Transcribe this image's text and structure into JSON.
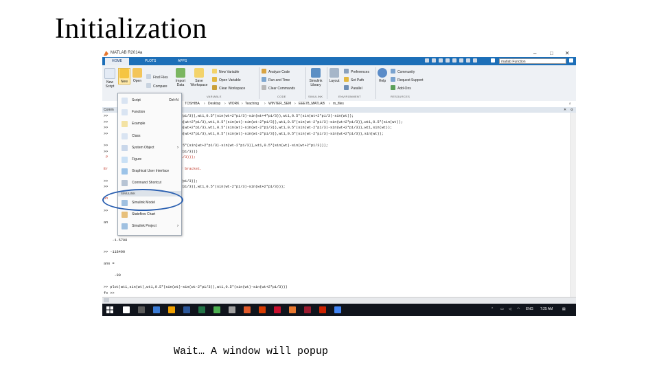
{
  "slide": {
    "title": "Initialization",
    "caption": "Wait… A window will popup"
  },
  "window": {
    "title": "MATLAB R2014a",
    "min": "–",
    "max": "□",
    "close": "✕"
  },
  "tabs": [
    "HOME",
    "PLOTS",
    "APPS"
  ],
  "search": {
    "value": "matlab Function"
  },
  "ribbon": {
    "new_script": "New\nScript",
    "new": "New",
    "open": "Open",
    "find_files": "Find Files",
    "compare": "Compare",
    "import_data": "Import\nData",
    "save_workspace": "Save\nWorkspace",
    "new_variable": "New Variable",
    "open_variable": "Open Variable",
    "clear_workspace": "Clear Workspace",
    "analyze_code": "Analyze Code",
    "run_and_time": "Run and Time",
    "clear_commands": "Clear Commands",
    "simulink_library": "Simulink\nLibrary",
    "layout": "Layout",
    "preferences": "Preferences",
    "set_path": "Set Path",
    "parallel": "Parallel",
    "help": "Help",
    "community": "Community",
    "request_support": "Request Support",
    "add_ons": "Add-Ons",
    "groups": [
      "VARIABLE",
      "CODE",
      "SIMULINK",
      "ENVIRONMENT",
      "RESOURCES"
    ]
  },
  "address": [
    "TOSHIBA",
    "Desktop",
    "WORK",
    "Teaching",
    "WINTER_SEM",
    "EEE78_MATLAB",
    "m_files"
  ],
  "command_window": {
    "title": "Comm",
    "lines": [
      {
        "text": ">>             0.5*(sin(wt)-sin(wt-2*pi/3)),wt1,0.5*(sin(wt+2*pi/3)-sin(wt+4*pi/3)),wt1,0.5*(sin(wt+2*pi/3)-sin(wt));",
        "err": false
      },
      {
        "text": ">>             sin(wt-2*pi/3),wt1,sin(wt+2*pi/3),wt1,0.5*(sin(wt)-sin(wt-2*pi/3)),wt1,0.5*(sin(wt-2*pi/3)-sin(wt+2*pi/3)),wt1,0.5*(sin(wt));",
        "err": false
      },
      {
        "text": ">>             sin(wt-2*pi/3),wt1,sin(wt+2*pi/3),wt1,0.5*(sin(wt)-sin(wt-2*pi/3)),wt1,0.5*(sin(wt-2*pi/3)-sin(wt+2*pi/3)),wt1,sin(wt));",
        "err": false
      },
      {
        "text": ">>             sin(wt-2*pi/3),wt1,sin(wt+2*pi/3),wt1,0.5*(sin(wt)-sin(wt-2*pi/3)),wt1,0.5*(sin(wt-2*pi/3)-sin(wt+2*pi/3)),sin(wt));",
        "err": false
      },
      {
        "text": "",
        "err": false
      },
      {
        "text": ">>             2*pi/3)-sin(wt),wt1,0.5*(sin(wt+2*pi/3)-sin(wt-2*pi/3)),wt1,0.5*(sin(wt)-sin(wt+2*pi/3)));",
        "err": false
      },
      {
        "text": ">>             0.5*(sin(wt)-sin(wt-2*pi/3)))",
        "err": false
      },
      {
        "text": " P             5*(sin(wt)-sin(wt-2*pi/3)));",
        "err": true
      },
      {
        "text": "                 |",
        "err": true
      },
      {
        "text": "Er             xpected parenthesis or bracket.",
        "err": true
      },
      {
        "text": "",
        "err": false
      },
      {
        "text": ">>             0.5*(sin(wt) sin(wt-2*pi/3));",
        "err": false
      },
      {
        "text": ">>             0.5*(sin(wt)-sin(wt+2*pi/3)),wt1,0.5*(sin(wt-2*pi/3)-sin(wt+2*pi/3)));",
        "err": false
      },
      {
        "text": "",
        "err": false
      },
      {
        "text": "Un             iable 'p'.",
        "err": true
      },
      {
        "text": "",
        "err": false
      },
      {
        "text": ">>",
        "err": false
      },
      {
        "text": "",
        "err": false
      },
      {
        "text": "an",
        "err": false
      },
      {
        "text": "",
        "err": false
      },
      {
        "text": "",
        "err": false
      },
      {
        "text": "    -1.5708",
        "err": false
      },
      {
        "text": "",
        "err": false
      },
      {
        "text": ">> -118490",
        "err": false
      },
      {
        "text": "",
        "err": false
      },
      {
        "text": "ans =",
        "err": false
      },
      {
        "text": "",
        "err": false
      },
      {
        "text": "     -90",
        "err": false
      },
      {
        "text": "",
        "err": false
      },
      {
        "text": ">> plot(wt1,sin(wt),wt1,0.5*(sin(wt)-sin(wt-2*pi/3)),wt1,0.5*(sin(wt)-sin(wt+2*pi/3)))",
        "err": false
      },
      {
        "text": "fx >>",
        "err": false
      }
    ]
  },
  "menu": {
    "items": [
      {
        "label": "Script",
        "shortcut": "Ctrl+N",
        "icon": "script-icon",
        "color": "#d9e4f2"
      },
      {
        "label": "Function",
        "shortcut": "",
        "icon": "function-icon",
        "color": "#d9e4f2"
      },
      {
        "label": "Example",
        "shortcut": "",
        "icon": "example-icon",
        "color": "#f3e2a3"
      },
      {
        "label": "Class",
        "shortcut": "",
        "icon": "class-icon",
        "color": "#d9e4f2"
      },
      {
        "label": "System Object",
        "shortcut": "",
        "icon": "system-object-icon",
        "color": "#c9d7ea",
        "arrow": "›"
      },
      {
        "label": "Figure",
        "shortcut": "",
        "icon": "figure-icon",
        "color": "#c9e0f5"
      },
      {
        "label": "Graphical User Interface",
        "shortcut": "",
        "icon": "gui-icon",
        "color": "#9cc3e8"
      },
      {
        "label": "Command Shortcut",
        "shortcut": "",
        "icon": "shortcut-icon",
        "color": "#b7c4d4"
      }
    ],
    "section": "SIMULINK",
    "simulink_items": [
      {
        "label": "Simulink Model",
        "icon": "simulink-model-icon",
        "color": "#9fc0e0"
      },
      {
        "label": "Stateflow Chart",
        "icon": "stateflow-icon",
        "color": "#e7c07c"
      },
      {
        "label": "Simulink Project",
        "icon": "simulink-project-icon",
        "color": "#9fc0e0",
        "arrow": "›"
      }
    ]
  },
  "taskbar": {
    "tray_lang": "ENG",
    "time": "7:25 AM",
    "start_icon": "windows-start-icon",
    "app_colors": [
      "#ffffff",
      "#5a5a5a",
      "#3a7bd5",
      "#f0a000",
      "#2b579a",
      "#217346",
      "#4caf50",
      "#a0a0a0",
      "#e05a2b",
      "#d83b01",
      "#c8102e",
      "#e8772e",
      "#9b1b30",
      "#cc2200",
      "#4285f4"
    ]
  },
  "colors": {
    "ribbon_bar": "#1d6fb8",
    "highlight_oval": "#2a5fb0",
    "error_text": "#c0392b"
  }
}
